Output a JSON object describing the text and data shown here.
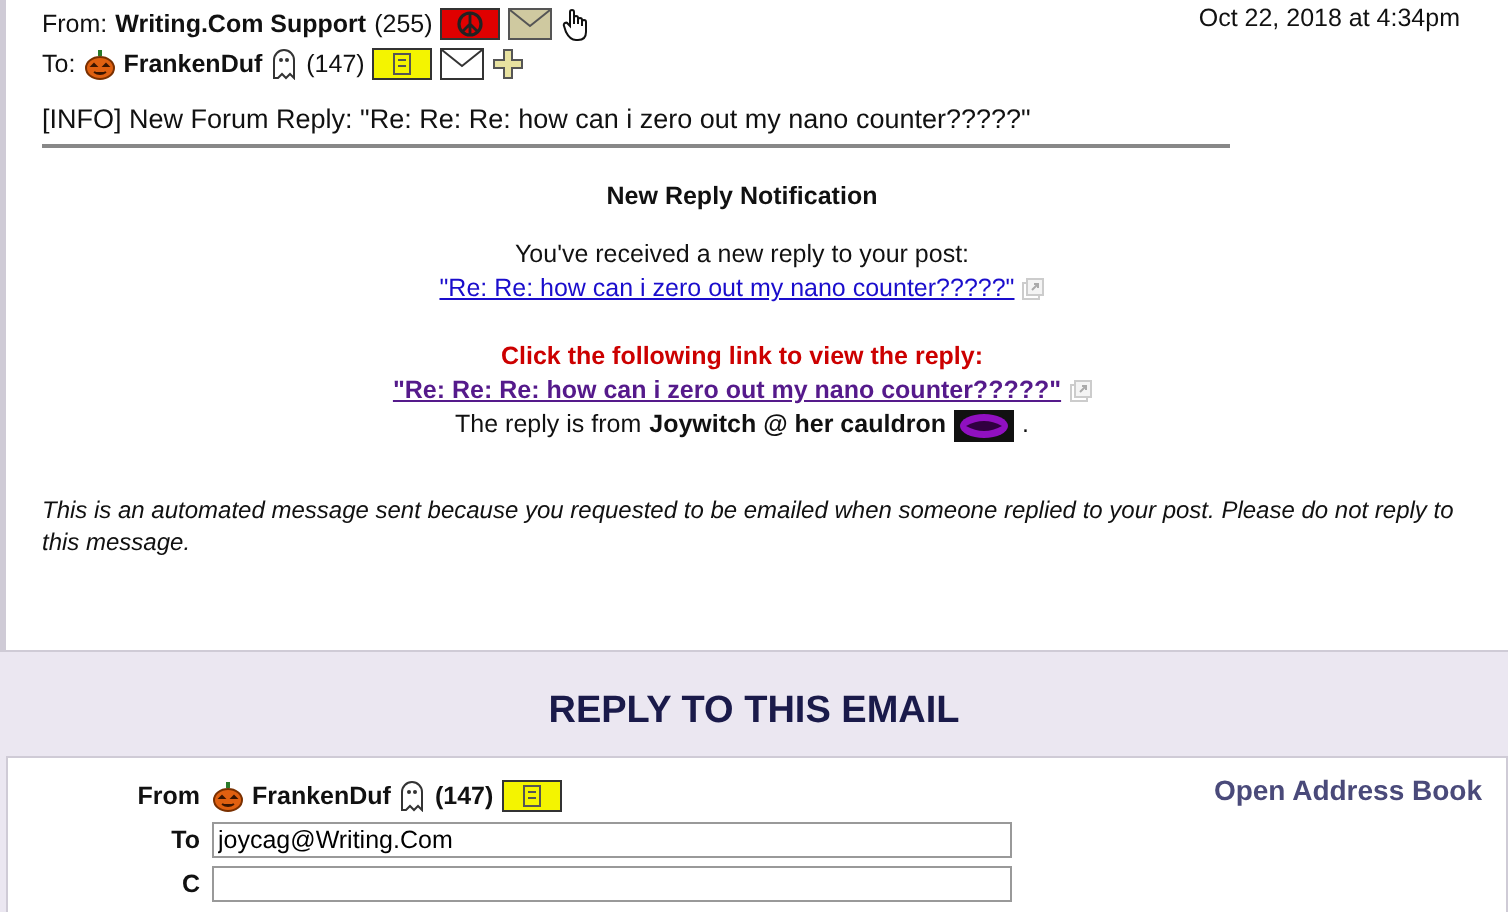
{
  "header": {
    "from_label": "From:",
    "from_name": "Writing.Com Support",
    "from_count": "(255)",
    "date": "Oct 22, 2018 at 4:34pm",
    "to_label": "To:",
    "to_name": "FrankenDuf",
    "to_count": "(147)"
  },
  "subject": "[INFO] New Forum Reply: \"Re: Re: Re: how can i zero out my nano counter?????\"",
  "body": {
    "title": "New Reply Notification",
    "intro": "You've received a new reply to your post:",
    "post_link": "\"Re: Re: how can i zero out my nano counter?????\"",
    "call_to_action": "Click the following link to view the reply:",
    "reply_link": "\"Re: Re: Re: how can i zero out my nano counter?????\"",
    "from_suffix": ".",
    "from_prefix": "The reply is from",
    "from_name": "Joywitch @ her cauldron",
    "footer": "This is an automated message sent because you requested to be emailed when someone replied to your post. Please do not reply to this message."
  },
  "reply": {
    "heading": "REPLY TO THIS EMAIL",
    "address_book": "Open Address Book",
    "from_label": "From",
    "from_name": "FrankenDuf",
    "from_count": "(147)",
    "to_label": "To",
    "to_value": "joycag@Writing.Com",
    "cc_label": "C"
  }
}
